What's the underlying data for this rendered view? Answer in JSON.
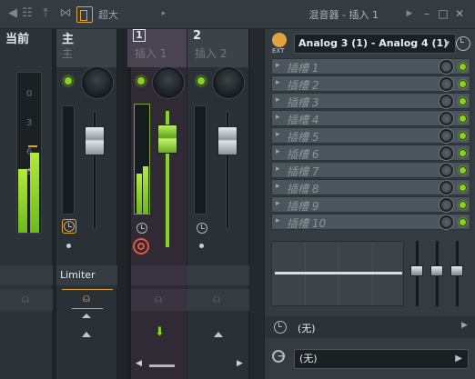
{
  "titlebar": {
    "size_label": "超大",
    "title": "混音器 - 插入 1"
  },
  "tracks": [
    {
      "name": "当前",
      "sub": "",
      "meter_labels": [
        "0",
        "3",
        "6",
        "9"
      ],
      "meter_level": 0.5
    },
    {
      "name": "主",
      "sub": "主",
      "effect_label": "Limiter"
    },
    {
      "name": "1",
      "sub": "插入 1",
      "meter_level": 0.4
    },
    {
      "name": "2",
      "sub": "插入 2"
    }
  ],
  "panel": {
    "preset": "Analog 3 (1) - Analog 4 (1)",
    "ext_label": "EXT",
    "slots": [
      "插槽 1",
      "插槽 2",
      "插槽 3",
      "插槽 4",
      "插槽 5",
      "插槽 6",
      "插槽 7",
      "插槽 8",
      "插槽 9",
      "插槽 10"
    ],
    "track_source": "(无)",
    "track_output": "(无)"
  },
  "colors": {
    "accent_orange": "#e0a43a",
    "led_green": "#86d321",
    "arm_red": "#e8553c"
  }
}
